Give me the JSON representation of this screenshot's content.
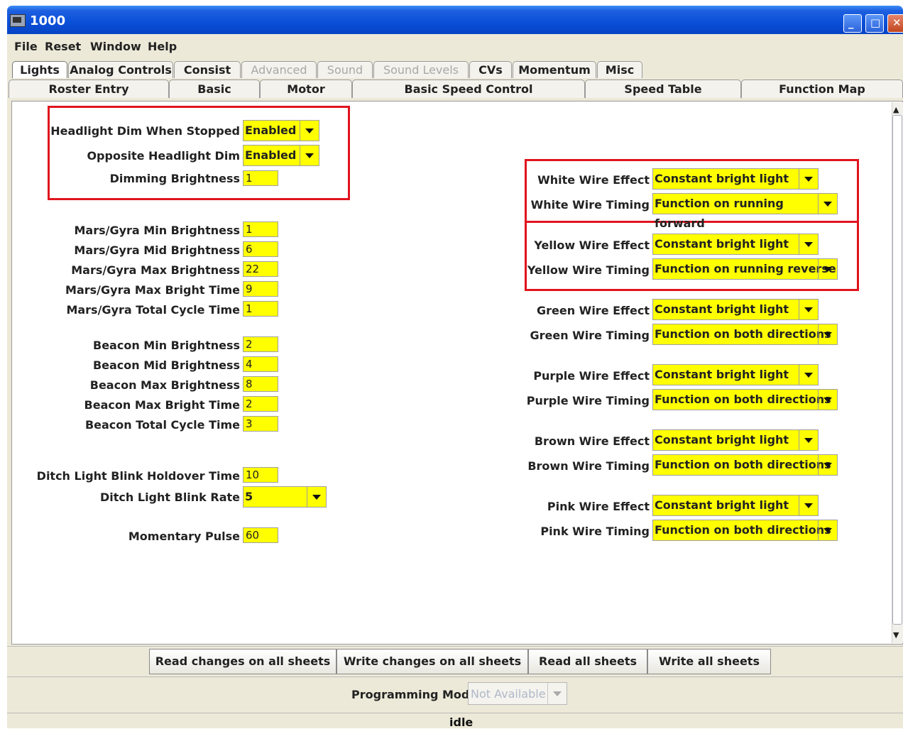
{
  "window": {
    "title": "1000"
  },
  "menu": [
    "File",
    "Reset",
    "Window",
    "Help"
  ],
  "tabs_row1": [
    {
      "label": "Lights",
      "enabled": true,
      "selected": true
    },
    {
      "label": "Analog Controls",
      "enabled": true
    },
    {
      "label": "Consist",
      "enabled": true
    },
    {
      "label": "Advanced",
      "enabled": false
    },
    {
      "label": "Sound",
      "enabled": false
    },
    {
      "label": "Sound Levels",
      "enabled": false
    },
    {
      "label": "CVs",
      "enabled": true
    },
    {
      "label": "Momentum",
      "enabled": true
    },
    {
      "label": "Misc",
      "enabled": true
    }
  ],
  "tabs_row2": [
    "Roster Entry",
    "Basic",
    "Motor",
    "Basic Speed Control",
    "Speed Table",
    "Function Map"
  ],
  "left": {
    "headlight_dim_label": "Headlight Dim When Stopped",
    "headlight_dim_value": "Enabled",
    "opposite_dim_label": "Opposite Headlight Dim",
    "opposite_dim_value": "Enabled",
    "dimming_label": "Dimming Brightness",
    "dimming_value": "1",
    "mars_min_label": "Mars/Gyra Min Brightness",
    "mars_min_value": "1",
    "mars_mid_label": "Mars/Gyra Mid Brightness",
    "mars_mid_value": "6",
    "mars_max_label": "Mars/Gyra Max Brightness",
    "mars_max_value": "22",
    "mars_maxtime_label": "Mars/Gyra Max Bright Time",
    "mars_maxtime_value": "9",
    "mars_cycle_label": "Mars/Gyra Total Cycle Time",
    "mars_cycle_value": "1",
    "beacon_min_label": "Beacon Min Brightness",
    "beacon_min_value": "2",
    "beacon_mid_label": "Beacon Mid Brightness",
    "beacon_mid_value": "4",
    "beacon_max_label": "Beacon Max Brightness",
    "beacon_max_value": "8",
    "beacon_maxtime_label": "Beacon Max Bright Time",
    "beacon_maxtime_value": "2",
    "beacon_cycle_label": "Beacon Total Cycle Time",
    "beacon_cycle_value": "3",
    "ditch_holdover_label": "Ditch Light Blink Holdover Time",
    "ditch_holdover_value": "10",
    "ditch_rate_label": "Ditch Light Blink Rate",
    "ditch_rate_value": "5",
    "momentary_label": "Momentary Pulse",
    "momentary_value": "60"
  },
  "right": {
    "white_effect_label": "White Wire Effect",
    "white_effect_value": "Constant bright light",
    "white_timing_label": "White Wire Timing",
    "white_timing_value": "Function on running forward",
    "yellow_effect_label": "Yellow Wire Effect",
    "yellow_effect_value": "Constant bright light",
    "yellow_timing_label": "Yellow Wire Timing",
    "yellow_timing_value": "Function on running reverse",
    "green_effect_label": "Green Wire Effect",
    "green_effect_value": "Constant bright light",
    "green_timing_label": "Green Wire Timing",
    "green_timing_value": "Function on both directions",
    "purple_effect_label": "Purple Wire Effect",
    "purple_effect_value": "Constant bright light",
    "purple_timing_label": "Purple Wire Timing",
    "purple_timing_value": "Function on both directions",
    "brown_effect_label": "Brown Wire Effect",
    "brown_effect_value": "Constant bright light",
    "brown_timing_label": "Brown Wire Timing",
    "brown_timing_value": "Function on both directions",
    "pink_effect_label": "Pink Wire Effect",
    "pink_effect_value": "Constant bright light",
    "pink_timing_label": "Pink Wire Timing",
    "pink_timing_value": "Function on both directions"
  },
  "buttons": {
    "read_changes": "Read changes on all sheets",
    "write_changes": "Write changes on all sheets",
    "read_all": "Read all sheets",
    "write_all": "Write all sheets"
  },
  "programming": {
    "label": "Programming Mode",
    "value": "Not Available"
  },
  "status": "idle",
  "colors": {
    "field": "#ffff00",
    "highlight_box": "#e0141e",
    "title_bar": "#0a4fd8"
  }
}
